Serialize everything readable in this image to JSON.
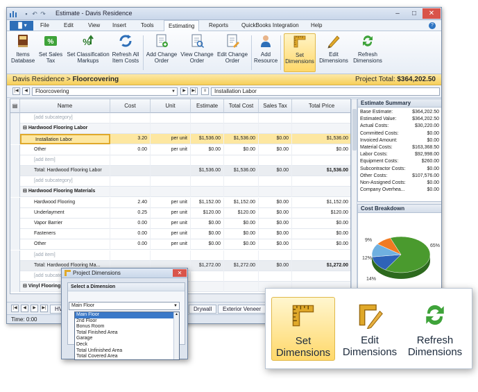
{
  "window": {
    "title": "Estimate - Davis Residence"
  },
  "menu": {
    "items": [
      "File",
      "Edit",
      "View",
      "Insert",
      "Tools",
      "Estimating",
      "Reports",
      "QuickBooks Integration",
      "Help"
    ],
    "active": "Estimating"
  },
  "ribbon": {
    "buttons": [
      {
        "l1": "Items",
        "l2": "Database"
      },
      {
        "l1": "Set Sales",
        "l2": "Tax"
      },
      {
        "l1": "Set Classification",
        "l2": "Markups"
      },
      {
        "l1": "Refresh All",
        "l2": "Item Costs"
      },
      {
        "l1": "Add Change",
        "l2": "Order"
      },
      {
        "l1": "View Change",
        "l2": "Order"
      },
      {
        "l1": "Edit Change",
        "l2": "Order"
      },
      {
        "l1": "Add",
        "l2": "Resource"
      },
      {
        "l1": "Set",
        "l2": "Dimensions"
      },
      {
        "l1": "Edit",
        "l2": "Dimensions"
      },
      {
        "l1": "Refresh",
        "l2": "Dimensions"
      }
    ]
  },
  "header": {
    "project": "Davis Residence",
    "separator": ">",
    "section": "Floorcovering",
    "total_label": "Project Total:",
    "total_value": "$364,202.50"
  },
  "navbar": {
    "combo1": "Floorcovering",
    "combo2": "Installation Labor"
  },
  "grid": {
    "columns": [
      "Name",
      "Cost",
      "Unit",
      "Estimate",
      "Total Cost",
      "Sales Tax",
      "Total Price"
    ],
    "rows": [
      {
        "type": "ph",
        "name": "[add subcategory]",
        "cost": "",
        "unit": "",
        "est": "",
        "tcost": "",
        "tax": "",
        "tprice": ""
      },
      {
        "type": "grp",
        "name": "Hardwood Flooring Labor",
        "cost": "",
        "unit": "",
        "est": "",
        "tcost": "",
        "tax": "",
        "tprice": ""
      },
      {
        "type": "sel",
        "name": "Installation Labor",
        "cost": "3.20",
        "unit": "per unit",
        "est": "$1,536.00",
        "tcost": "$1,536.00",
        "tax": "$0.00",
        "tprice": "$1,536.00"
      },
      {
        "type": "item",
        "name": "Other",
        "cost": "0.00",
        "unit": "per unit",
        "est": "$0.00",
        "tcost": "$0.00",
        "tax": "$0.00",
        "tprice": "$0.00"
      },
      {
        "type": "ph",
        "name": "[add item]",
        "cost": "",
        "unit": "",
        "est": "",
        "tcost": "",
        "tax": "",
        "tprice": ""
      },
      {
        "type": "tot",
        "name": "Total: Hardwood Flooring Labor",
        "cost": "",
        "unit": "",
        "est": "$1,536.00",
        "tcost": "$1,536.00",
        "tax": "$0.00",
        "tprice": "$1,536.00"
      },
      {
        "type": "ph",
        "name": "[add subcategory]",
        "cost": "",
        "unit": "",
        "est": "",
        "tcost": "",
        "tax": "",
        "tprice": ""
      },
      {
        "type": "grp",
        "name": "Hardwood Flooring Materials",
        "cost": "",
        "unit": "",
        "est": "",
        "tcost": "",
        "tax": "",
        "tprice": ""
      },
      {
        "type": "item",
        "name": "Hardwood Flooring",
        "cost": "2.40",
        "unit": "per unit",
        "est": "$1,152.00",
        "tcost": "$1,152.00",
        "tax": "$0.00",
        "tprice": "$1,152.00"
      },
      {
        "type": "item",
        "name": "Underlayment",
        "cost": "0.25",
        "unit": "per unit",
        "est": "$120.00",
        "tcost": "$120.00",
        "tax": "$0.00",
        "tprice": "$120.00"
      },
      {
        "type": "item",
        "name": "Vapor Barrier",
        "cost": "0.00",
        "unit": "per unit",
        "est": "$0.00",
        "tcost": "$0.00",
        "tax": "$0.00",
        "tprice": "$0.00"
      },
      {
        "type": "item",
        "name": "Fasteners",
        "cost": "0.00",
        "unit": "per unit",
        "est": "$0.00",
        "tcost": "$0.00",
        "tax": "$0.00",
        "tprice": "$0.00"
      },
      {
        "type": "item",
        "name": "Other",
        "cost": "0.00",
        "unit": "per unit",
        "est": "$0.00",
        "tcost": "$0.00",
        "tax": "$0.00",
        "tprice": "$0.00"
      },
      {
        "type": "ph",
        "name": "[add item]",
        "cost": "",
        "unit": "",
        "est": "",
        "tcost": "",
        "tax": "",
        "tprice": ""
      },
      {
        "type": "tot",
        "name": "Total: Hardwood Flooring Ma...",
        "cost": "",
        "unit": "",
        "est": "$1,272.00",
        "tcost": "$1,272.00",
        "tax": "$0.00",
        "tprice": "$1,272.00"
      },
      {
        "type": "ph",
        "name": "[add subcategory]",
        "cost": "",
        "unit": "",
        "est": "",
        "tcost": "",
        "tax": "",
        "tprice": ""
      },
      {
        "type": "grp",
        "name": "Vinyl Flooring",
        "cost": "",
        "unit": "",
        "est": "",
        "tcost": "",
        "tax": "",
        "tprice": ""
      }
    ]
  },
  "tabs": [
    "HVA",
    "Drywall",
    "Exterior Veneer"
  ],
  "status": {
    "time": "Time: 0:00"
  },
  "summary": {
    "title": "Estimate Summary",
    "rows": [
      {
        "k": "Base Estimate:",
        "v": "$364,202.50"
      },
      {
        "k": "Estimated Value:",
        "v": "$364,202.50"
      },
      {
        "k": "Actual Costs:",
        "v": "$30,220.00"
      },
      {
        "k": "Committed Costs:",
        "v": "$0.00"
      },
      {
        "k": "Invoiced Amount:",
        "v": "$0.00"
      },
      {
        "k": "Material Costs:",
        "v": "$163,368.50"
      },
      {
        "k": "Labor Costs:",
        "v": "$92,998.00"
      },
      {
        "k": "Equipment Costs:",
        "v": "$260.00"
      },
      {
        "k": "Subcontractor Costs:",
        "v": "$0.00"
      },
      {
        "k": "Other Costs:",
        "v": "$107,576.00"
      },
      {
        "k": "Non-Assigned Costs:",
        "v": "$0.00"
      },
      {
        "k": "Company Overhea...",
        "v": "$0.00"
      }
    ]
  },
  "breakdown": {
    "title": "Cost Breakdown",
    "slice_labels": [
      "9%",
      "12%",
      "14%",
      "65%"
    ]
  },
  "chart_data": {
    "type": "pie",
    "title": "Cost Breakdown",
    "values": [
      65,
      14,
      12,
      9
    ],
    "colors": [
      "#4a9a2e",
      "#2e63b8",
      "#6fb0e0",
      "#f07a22"
    ],
    "labels": [
      "65%",
      "14%",
      "12%",
      "9%"
    ]
  },
  "dialog": {
    "title": "Project Dimensions",
    "panel_title": "Select a Dimension",
    "selected": "Main Floor",
    "options": [
      "Main Floor",
      "2nd Floor",
      "Bonus Room",
      "Total Finished Area",
      "Garage",
      "Deck",
      "Total Unfinished Area",
      "Total Covered Area"
    ]
  },
  "zoom": {
    "buttons": [
      {
        "l1": "Set",
        "l2": "Dimensions"
      },
      {
        "l1": "Edit",
        "l2": "Dimensions"
      },
      {
        "l1": "Refresh",
        "l2": "Dimensions"
      }
    ]
  },
  "colors": {
    "accent": "#2e6fb8",
    "highlight": "#ffd86a",
    "header_band": "#f6cf5a"
  }
}
